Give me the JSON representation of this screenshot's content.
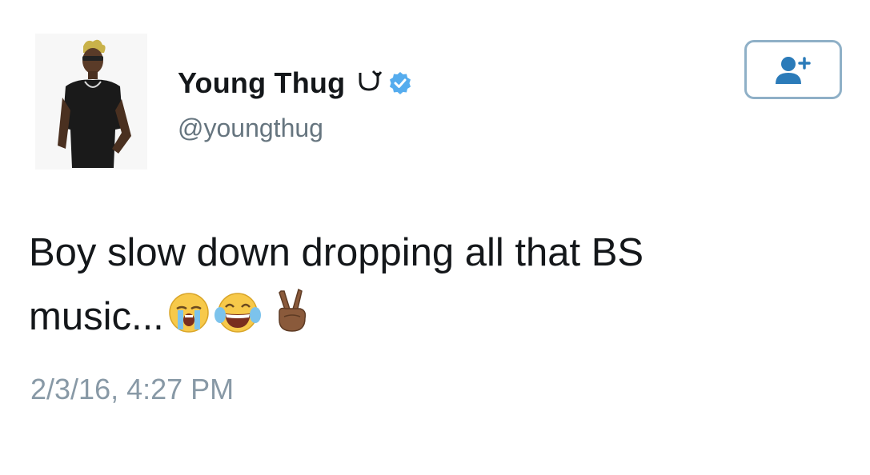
{
  "tweet": {
    "display_name": "Young Thug",
    "name_symbol": "∪͡",
    "handle": "@youngthug",
    "text_line1": "Boy slow down dropping all that BS",
    "text_line2": "music...",
    "emojis": [
      "loudly-crying-face",
      "face-with-tears-of-joy",
      "victory-hand"
    ],
    "timestamp": "2/3/16, 4:27 PM",
    "verified": true
  },
  "follow_button": {
    "icon": "add-user-icon"
  },
  "colors": {
    "text": "#14171a",
    "secondary": "#66757f",
    "verified_blue": "#55acee",
    "button_border": "#8fb0c7",
    "button_icon": "#2b7bb9"
  }
}
